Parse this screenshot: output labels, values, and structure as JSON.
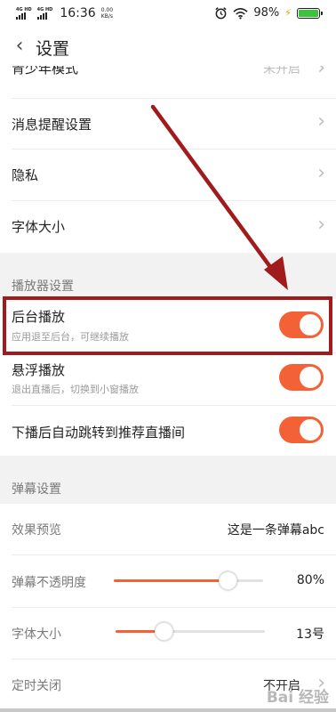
{
  "status_bar": {
    "signal1_label": "4G HD",
    "signal2_label": "4G HD",
    "time": "16:36",
    "speed_value": "0.00",
    "speed_unit": "KB/s",
    "battery_text": "98%",
    "icons": [
      "alarm-icon",
      "wifi-icon",
      "battery-icon"
    ]
  },
  "header": {
    "back_icon": "chevron-left-icon",
    "title": "设置"
  },
  "rows_top": [
    {
      "label": "青少年模式",
      "value": "未开启"
    },
    {
      "label": "消息提醒设置"
    },
    {
      "label": "隐私"
    },
    {
      "label": "字体大小"
    }
  ],
  "player_section": {
    "title": "播放器设置",
    "items": [
      {
        "label": "后台播放",
        "sub": "应用退至后台，可继续播放",
        "enabled": true
      },
      {
        "label": "悬浮播放",
        "sub": "退出直播后，切换到小窗播放",
        "enabled": true
      },
      {
        "label": "下播后自动跳转到推荐直播间",
        "enabled": true
      }
    ]
  },
  "danmaku_section": {
    "title": "弹幕设置",
    "preview_label": "效果预览",
    "preview_text": "这是一条弹幕abc",
    "opacity_label": "弹幕不透明度",
    "opacity_value": "80%",
    "opacity_fraction": 0.8,
    "fontsize_label": "字体大小",
    "fontsize_value": "13号",
    "fontsize_fraction": 0.3,
    "timer_label": "定时关闭",
    "timer_value": "不开启"
  },
  "colors": {
    "accent": "#f26236",
    "highlight": "#a11a1c",
    "section_bg": "#f2f2f2"
  },
  "watermark": "Bai 经验"
}
